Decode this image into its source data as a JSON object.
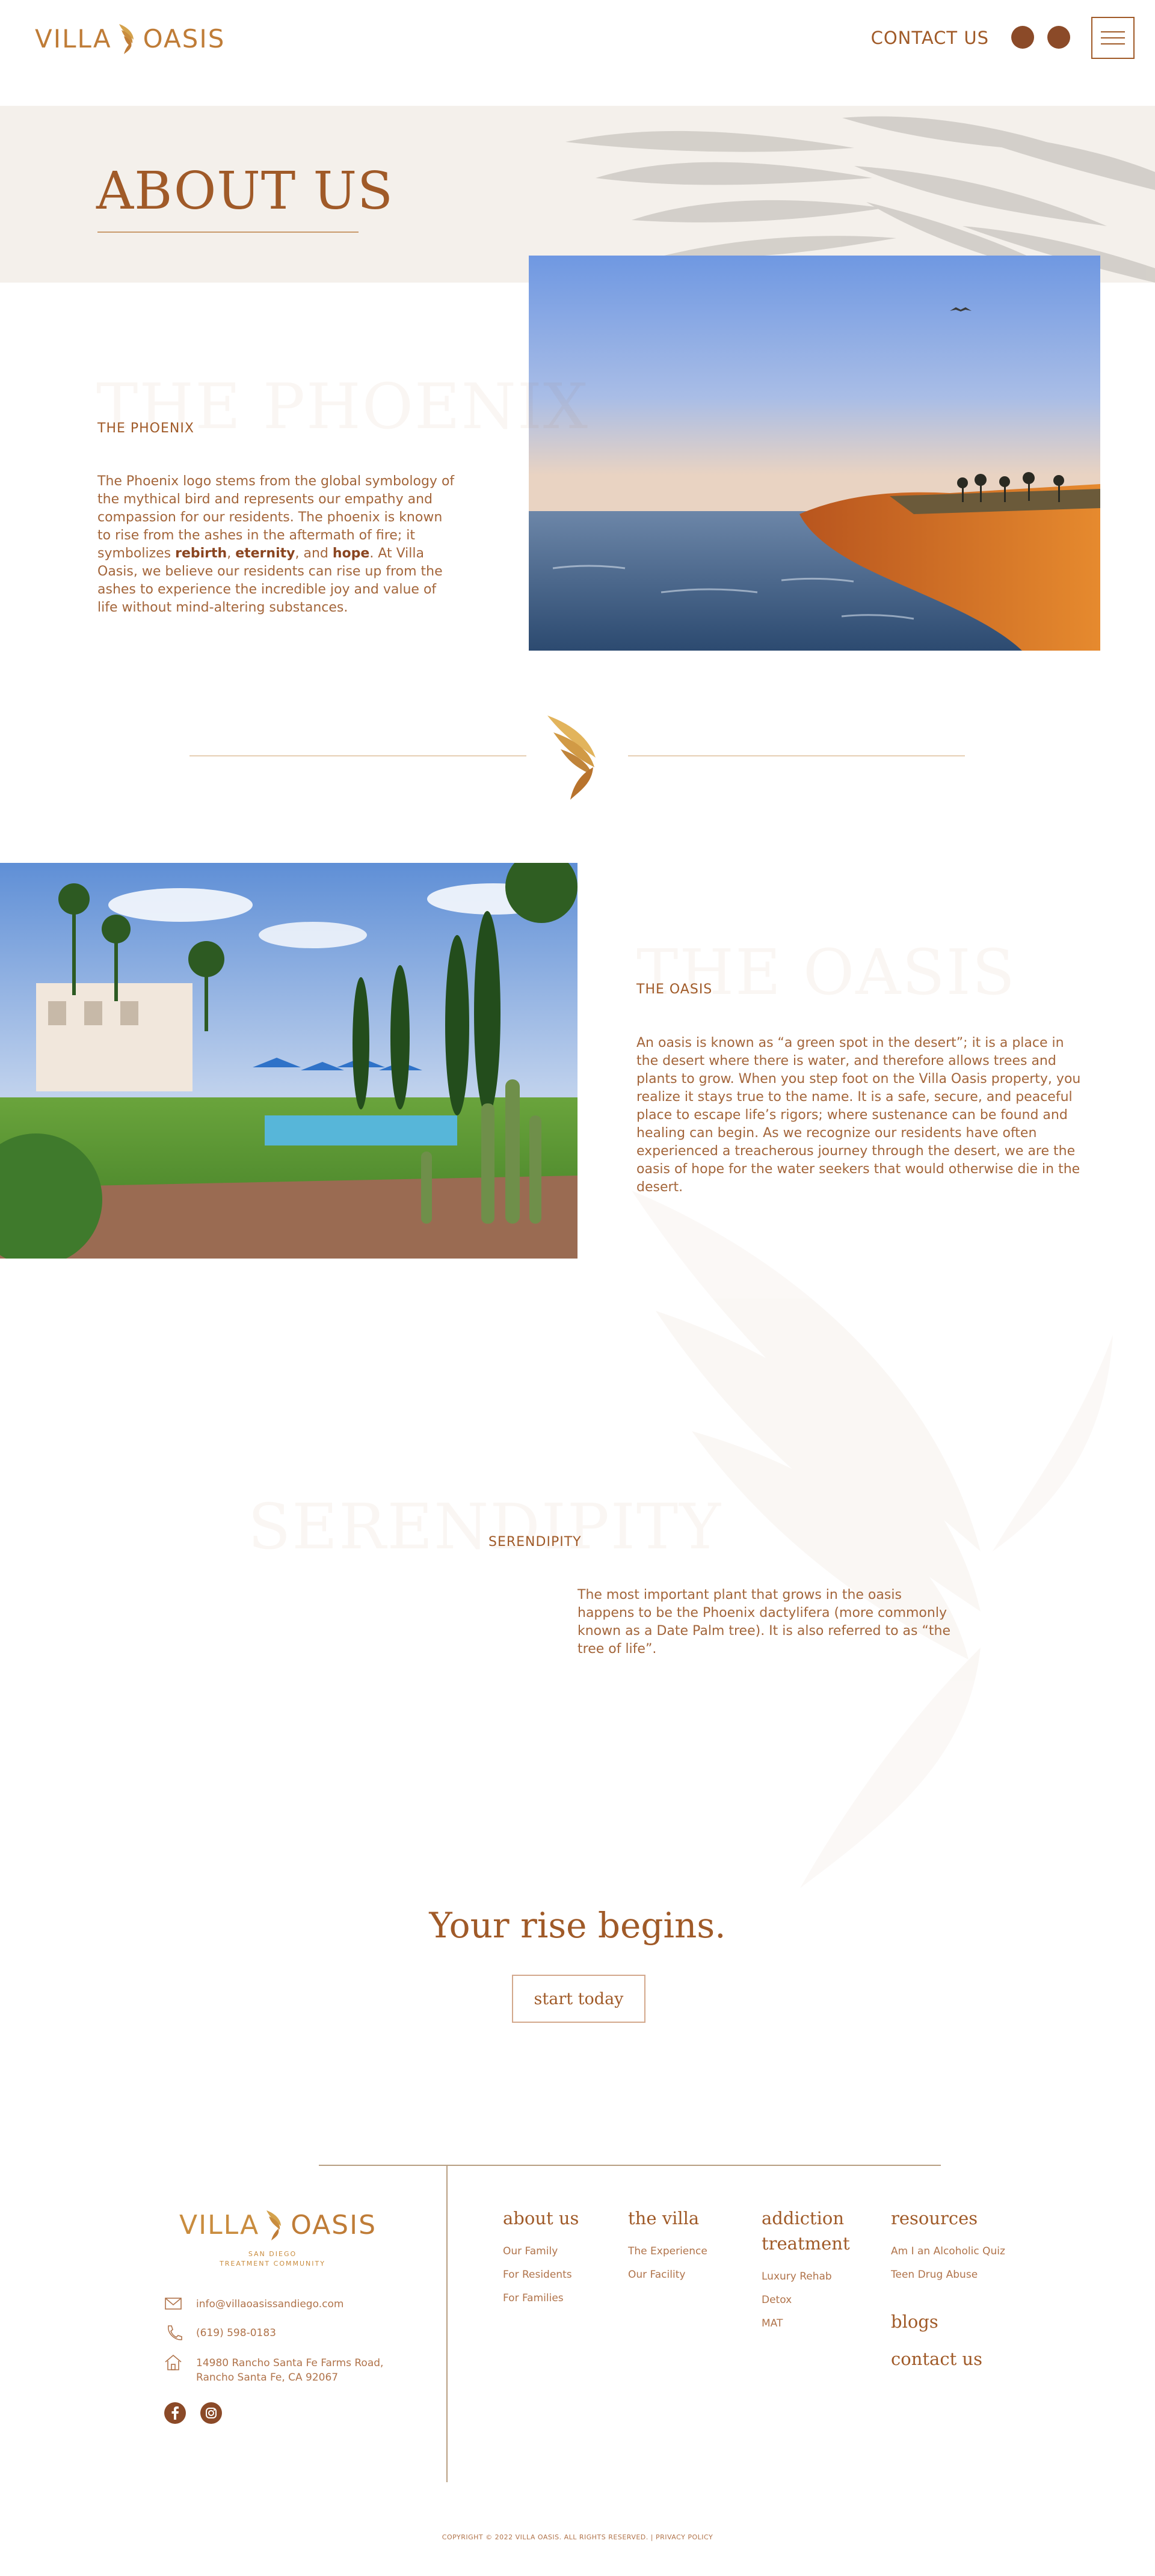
{
  "header": {
    "logo_left": "VILLA",
    "logo_right": "OASIS",
    "contact_label": "CONTACT US",
    "social": [
      "facebook-icon",
      "instagram-icon"
    ],
    "menu_icon": "hamburger-menu-icon"
  },
  "hero": {
    "title": "ABOUT US"
  },
  "phoenix": {
    "bg_word": "THE PHOENIX",
    "label": "THE PHOENIX",
    "body_1": "The Phoenix logo stems from the global symbology of the mythical bird and represents our empathy and compassion for our residents. The phoenix is known to rise from the ashes in the aftermath of fire; it symbolizes ",
    "bold_1": "rebirth",
    "sep_1": ", ",
    "bold_2": "eternity",
    "sep_2": ", and ",
    "bold_3": "hope",
    "body_2": ". At Villa Oasis, we believe our residents can rise up from the ashes to experience the incredible joy and value of life without mind-altering substances."
  },
  "oasis": {
    "bg_word": "THE OASIS",
    "label": "THE OASIS",
    "body": "An oasis is known as “a green spot in the desert”; it is a place in the desert where there is water, and therefore allows trees and plants to grow. When you step foot on the Villa Oasis property, you realize it stays true to the name. It is a safe, secure, and peaceful place to escape life’s rigors; where sustenance can be found and healing can begin. As we recognize our residents have often experienced a treacherous journey through the desert, we are the oasis of hope for the water seekers that would otherwise die in the desert."
  },
  "serendipity": {
    "bg_word": "SERENDIPITY",
    "label": "SERENDIPITY",
    "body": "The most important plant that grows in the oasis happens to be the Phoenix dactylifera (more commonly known as a Date Palm tree). It is also referred to as “the tree of life”."
  },
  "cta": {
    "title": "Your rise begins.",
    "button": "start today"
  },
  "footer": {
    "logo_left": "VILLA",
    "logo_right": "OASIS",
    "tagline_1": "SAN DIEGO",
    "tagline_2": "TREATMENT COMMUNITY",
    "email": "info@villaoasissandiego.com",
    "phone": "(619) 598-0183",
    "address_1": "14980 Rancho Santa Fe Farms Road,",
    "address_2": "Rancho Santa Fe, CA 92067",
    "columns": {
      "about": {
        "title": "about us",
        "links": [
          "Our Family",
          "For Residents",
          "For Families"
        ]
      },
      "villa": {
        "title": "the villa",
        "links": [
          "The Experience",
          "Our Facility"
        ]
      },
      "addiction": {
        "title_1": "addiction",
        "title_2": "treatment",
        "links": [
          "Luxury Rehab",
          "Detox",
          "MAT"
        ]
      },
      "resources": {
        "title": "resources",
        "links": [
          "Am I an Alcoholic Quiz",
          "Teen Drug Abuse"
        ]
      },
      "blogs": "blogs",
      "contact": "contact us"
    },
    "copyright": "COPYRIGHT © 2022 VILLA OASIS. ALL RIGHTS RESERVED. | PRIVACY POLICY"
  },
  "colors": {
    "brand": "#a05a28",
    "gold": "#c98c3e",
    "hero_band": "#f4f0eb",
    "social": "#8b4a28"
  }
}
